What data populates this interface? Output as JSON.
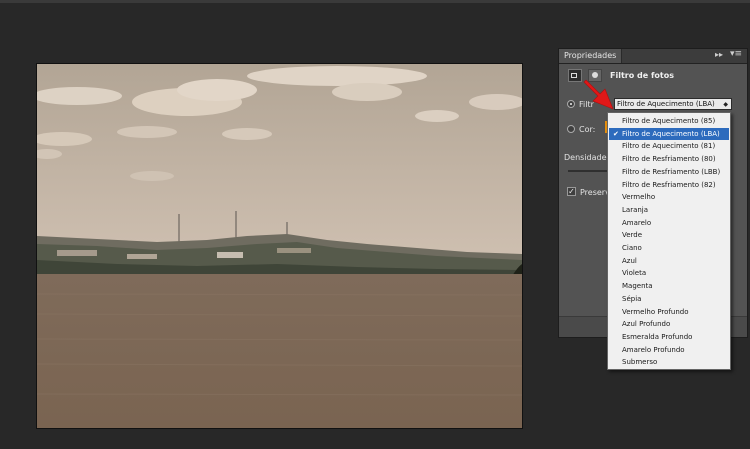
{
  "panel": {
    "tab_label": "Propriedades",
    "collapse_glyph": "▸▸",
    "menu_glyph": "▾≡",
    "title": "Filtro de fotos",
    "filter_label": "Filtr",
    "color_label": "Cor:",
    "density_label": "Densidade",
    "preserve_label": "Preserv",
    "selected_filter": "Filtro de Aquecimento (LBA)",
    "select_arrow": "◆",
    "color_swatch": "#e8900c"
  },
  "dropdown": {
    "check_glyph": "✔",
    "selected_index": 1,
    "items": [
      "Filtro de Aquecimento (85)",
      "Filtro de Aquecimento (LBA)",
      "Filtro de Aquecimento (81)",
      "Filtro de Resfriamento (80)",
      "Filtro de Resfriamento (LBB)",
      "Filtro de Resfriamento (82)",
      "Vermelho",
      "Laranja",
      "Amarelo",
      "Verde",
      "Ciano",
      "Azul",
      "Violeta",
      "Magenta",
      "Sépia",
      "Vermelho Profundo",
      "Azul Profundo",
      "Esmeralda Profundo",
      "Amarelo Profundo",
      "Submerso"
    ]
  },
  "colors": {
    "selection": "#2d6bbd",
    "annotation_arrow": "#e01818"
  }
}
